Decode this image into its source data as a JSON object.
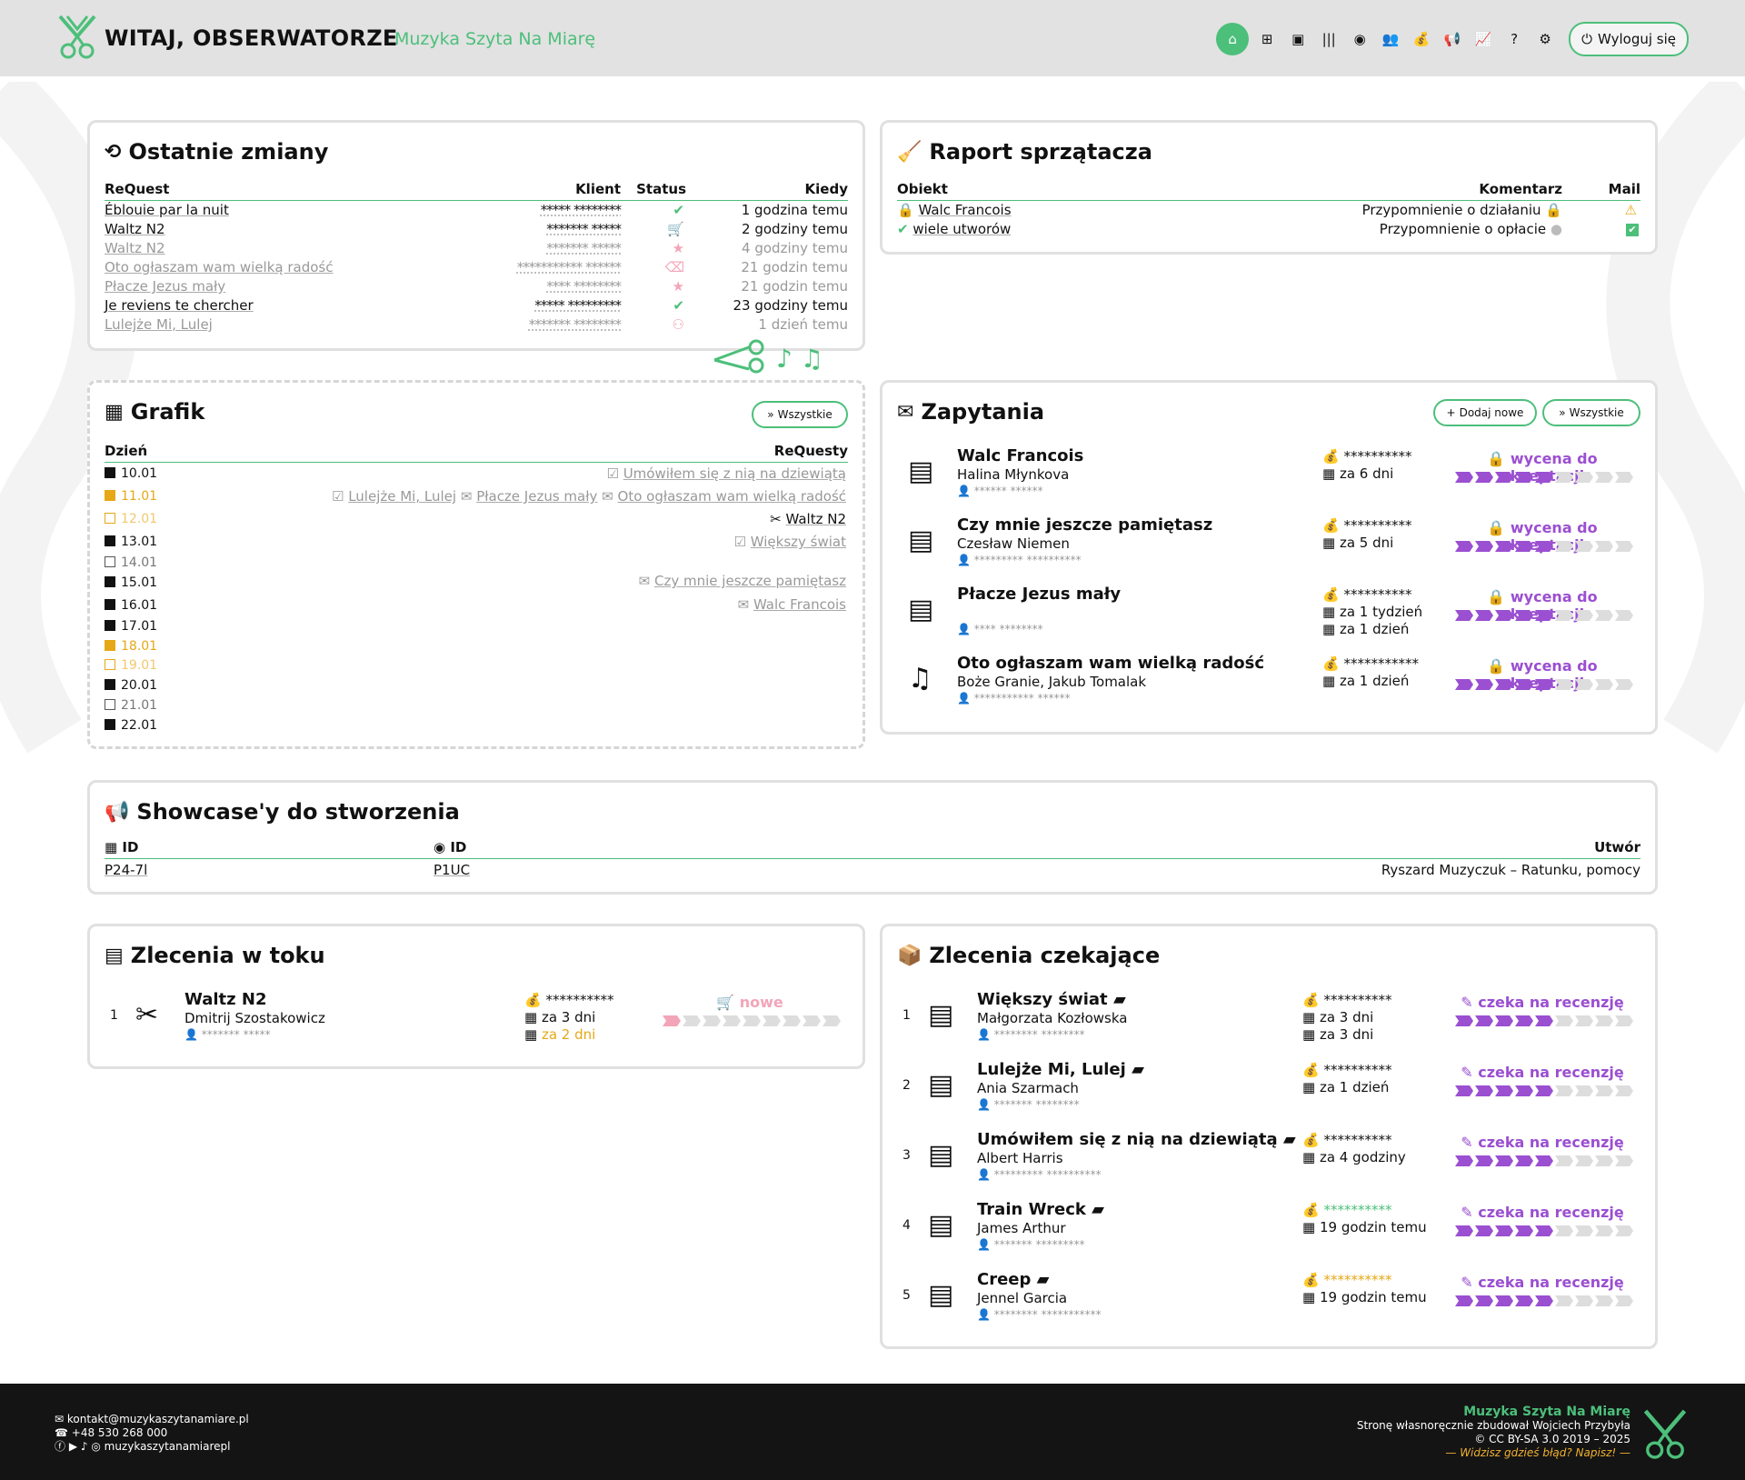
{
  "header": {
    "title": "WITAJ, OBSERWATORZE",
    "subtitle": "Muzyka Szyta Na Miarę",
    "logout": "Wyloguj się",
    "nav_icons": [
      "home-icon",
      "sitemap-icon",
      "box-icon",
      "barcode-icon",
      "record-icon",
      "users-icon",
      "money-bag-icon",
      "megaphone-icon",
      "chart-icon",
      "help-icon",
      "gear-icon"
    ]
  },
  "recent": {
    "title": "Ostatnie zmiany",
    "cols": {
      "request": "ReQuest",
      "client": "Klient",
      "status": "Status",
      "when": "Kiedy"
    },
    "rows": [
      {
        "title": "Éblouie par la nuit",
        "client": "***** ********",
        "status": "✔",
        "when": "1 godzina temu",
        "dim": false
      },
      {
        "title": "Waltz N2",
        "client": "******* *****",
        "status": "🛒",
        "when": "2 godziny temu",
        "dim": false
      },
      {
        "title": "Waltz N2",
        "client": "******* *****",
        "status": "★",
        "when": "4 godziny temu",
        "dim": true
      },
      {
        "title": "Oto ogłaszam wam wielką radość",
        "client": "*********** ******",
        "status": "⌫",
        "when": "21 godzin temu",
        "dim": true
      },
      {
        "title": "Płacze Jezus mały",
        "client": "**** ********",
        "status": "★",
        "when": "21 godzin temu",
        "dim": true
      },
      {
        "title": "Je reviens te chercher",
        "client": "***** *********",
        "status": "✔",
        "when": "23 godziny temu",
        "dim": false
      },
      {
        "title": "Lulejże Mi, Lulej",
        "client": "******* ********",
        "status": "⚇",
        "when": "1 dzień temu",
        "dim": true
      }
    ]
  },
  "janitor": {
    "title": "Raport sprzątacza",
    "cols": {
      "object": "Obiekt",
      "comment": "Komentarz",
      "mail": "Mail"
    },
    "rows": [
      {
        "object": "Walc Francois",
        "comment": "Przypomnienie o działaniu",
        "mail": "⚠"
      },
      {
        "object": "wiele utworów",
        "comment": "Przypomnienie o opłacie",
        "mail": "✔"
      }
    ]
  },
  "schedule": {
    "title": "Grafik",
    "all": "Wszystkie",
    "cols": {
      "day": "Dzień",
      "requests": "ReQuesty"
    },
    "days": [
      {
        "d": "10.01",
        "type": "full",
        "items": [
          "Umówiłem się z nią na dziewiątą"
        ]
      },
      {
        "d": "11.01",
        "type": "gold",
        "items": [
          "Lulejże Mi, Lulej",
          "Płacze Jezus mały",
          "Oto ogłaszam wam wielką radość"
        ]
      },
      {
        "d": "12.01",
        "type": "gold-empty",
        "items": []
      },
      {
        "d": "13.01",
        "type": "full",
        "items": []
      },
      {
        "d": "14.01",
        "type": "empty",
        "items": []
      },
      {
        "d": "15.01",
        "type": "full",
        "items": []
      },
      {
        "d": "16.01",
        "type": "full",
        "items": []
      },
      {
        "d": "17.01",
        "type": "full",
        "items": []
      },
      {
        "d": "18.01",
        "type": "gold",
        "items": []
      },
      {
        "d": "19.01",
        "type": "gold-empty",
        "items": []
      },
      {
        "d": "20.01",
        "type": "full",
        "items": []
      },
      {
        "d": "21.01",
        "type": "empty",
        "items": []
      },
      {
        "d": "22.01",
        "type": "full",
        "items": []
      }
    ],
    "extra": [
      {
        "text": "Waltz N2"
      },
      {
        "text": "Większy świat"
      },
      {
        "text": "Czy mnie jeszcze pamiętasz"
      },
      {
        "text": "Walc Francois"
      }
    ]
  },
  "inquiries": {
    "title": "Zapytania",
    "add": "Dodaj nowe",
    "all": "Wszystkie",
    "rows": [
      {
        "title": "Walc Francois",
        "artist": "Halina Młynkova",
        "client": "****** ******",
        "price": "**********",
        "due": [
          "za 6 dni"
        ],
        "status": "wycena do akceptacji"
      },
      {
        "title": "Czy mnie jeszcze pamiętasz",
        "artist": "Czesław Niemen",
        "client": "********* **********",
        "price": "**********",
        "due": [
          "za 5 dni"
        ],
        "status": "wycena do akceptacji"
      },
      {
        "title": "Płacze Jezus mały",
        "artist": "",
        "client": "**** ********",
        "price": "**********",
        "due": [
          "za 1 tydzień",
          "za 1 dzień"
        ],
        "status": "wycena do akceptacji"
      },
      {
        "title": "Oto ogłaszam wam wielką radość",
        "artist": "Boże Granie, Jakub Tomalak",
        "client": "*********** ******",
        "price": "***********",
        "due": [
          "za 1 dzień"
        ],
        "status": "wycena do akceptacji"
      }
    ]
  },
  "showcases": {
    "title": "Showcase'y do stworzenia",
    "cols": {
      "id1": "ID",
      "id2": "ID",
      "song": "Utwór"
    },
    "row": {
      "id1": "P24-7l",
      "id2": "P1UC",
      "song": "Ryszard Muzyczuk – Ratunku, pomocy"
    }
  },
  "inprogress": {
    "title": "Zlecenia w toku",
    "rows": [
      {
        "n": "1",
        "title": "Waltz N2",
        "artist": "Dmitrij Szostakowicz",
        "client": "******* *****",
        "price": "**********",
        "due": [
          "za 3 dni",
          "za 2 dni"
        ],
        "status": "nowe"
      }
    ]
  },
  "waiting": {
    "title": "Zlecenia czekające",
    "rows": [
      {
        "n": "1",
        "title": "Większy świat",
        "artist": "Małgorzata Kozłowska",
        "client": "******** ********",
        "price": "**********",
        "due": [
          "za 3 dni",
          "za 3 dni"
        ],
        "status": "czeka na recenzję"
      },
      {
        "n": "2",
        "title": "Lulejże Mi, Lulej",
        "artist": "Ania Szarmach",
        "client": "******* ********",
        "price": "**********",
        "due": [
          "za 1 dzień"
        ],
        "status": "czeka na recenzję"
      },
      {
        "n": "3",
        "title": "Umówiłem się z nią na dziewiątą",
        "artist": "Albert Harris",
        "client": "********* **********",
        "price": "**********",
        "due": [
          "za 4 godziny"
        ],
        "status": "czeka na recenzję"
      },
      {
        "n": "4",
        "title": "Train Wreck",
        "artist": "James Arthur",
        "client": "******* *********",
        "price": "**********",
        "due": [
          "19 godzin temu"
        ],
        "status": "czeka na recenzję"
      },
      {
        "n": "5",
        "title": "Creep",
        "artist": "Jennel Garcia",
        "client": "******** ***********",
        "price": "**********",
        "due": [
          "19 godzin temu"
        ],
        "status": "czeka na recenzję"
      }
    ]
  },
  "footer": {
    "email": "kontakt@muzykaszytanamiare.pl",
    "phone": "+48 530 268 000",
    "social": "muzykaszytanamiarepl",
    "brand": "Muzyka Szyta Na Miarę",
    "built": "Stronę własnoręcznie zbudował Wojciech Przybyła",
    "license": "© CC BY-SA 3.0 2019 – 2025",
    "error": "— Widzisz gdzieś błąd? Napisz! —"
  },
  "colors": {
    "accent": "#4cbf7a",
    "purple": "#9b4fd1",
    "gold": "#e6a817",
    "pink": "#f3a5b8"
  }
}
